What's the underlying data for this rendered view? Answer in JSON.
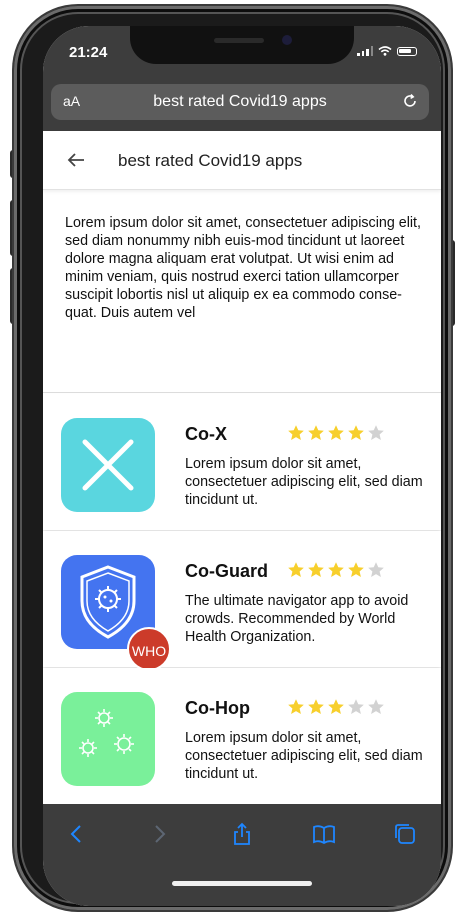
{
  "status": {
    "time": "21:24"
  },
  "browser": {
    "text_size_label": "aA",
    "url": "best rated Covid19 apps"
  },
  "header": {
    "title": "best rated Covid19 apps"
  },
  "intro": "Lorem ipsum dolor sit amet, consectetuer adipiscing elit, sed diam nonummy nibh euis-mod tincidunt ut laoreet dolore magna aliquam erat volutpat. Ut wisi enim ad minim veniam, quis nostrud exerci tation ullamcorper suscipit lobortis nisl ut aliquip ex ea commodo conse-quat. Duis autem vel",
  "apps": [
    {
      "name": "Co-X",
      "rating": 4,
      "max_rating": 5,
      "icon": "x-cross-icon",
      "color": "#5ad6df",
      "desc": "Lorem ipsum dolor sit amet, consectetuer adipiscing elit, sed diam tincidunt ut."
    },
    {
      "name": "Co-Guard",
      "rating": 4,
      "max_rating": 5,
      "icon": "shield-virus-icon",
      "color": "#4474f0",
      "badge": "WHO",
      "desc": "The ultimate navigator app to avoid crowds. Recommended by World Health Organization."
    },
    {
      "name": "Co-Hop",
      "rating": 3,
      "max_rating": 5,
      "icon": "virus-cluster-icon",
      "color": "#7af09a",
      "desc": "Lorem ipsum dolor sit amet, consectetuer adipiscing elit, sed diam tincidunt ut."
    }
  ],
  "colors": {
    "star_filled": "#f7cf2c",
    "star_empty": "#d2d2d2",
    "accent": "#1e86ff"
  },
  "toolbar": {
    "icons": [
      "back-arrow-icon",
      "forward-arrow-icon",
      "share-icon",
      "bookmarks-icon",
      "tabs-icon"
    ]
  }
}
